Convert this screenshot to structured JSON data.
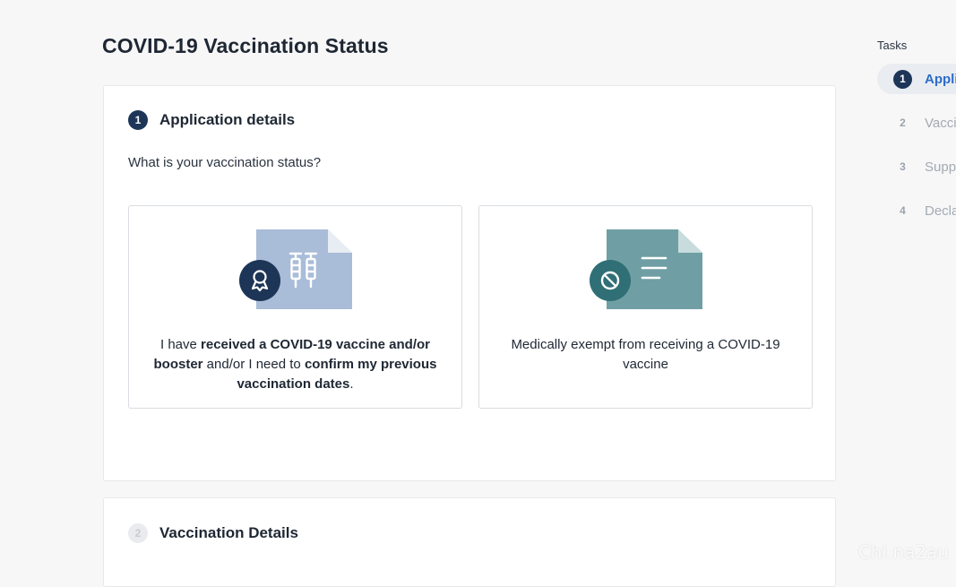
{
  "page": {
    "title": "COVID-19 Vaccination Status"
  },
  "step1": {
    "number": "1",
    "heading": "Application details",
    "question": "What is your vaccination status?",
    "option_vaccinated": {
      "t1": "I have ",
      "b1": "received a COVID-19 vaccine and/or booster",
      "t2": " and/or I need to ",
      "b2": "confirm my previous vaccination dates",
      "t3": ".",
      "icon": "vaccine-certificate-icon"
    },
    "option_exempt": {
      "text": "Medically exempt from receiving a COVID-19 vaccine",
      "icon": "exemption-document-icon"
    }
  },
  "step2": {
    "number": "2",
    "heading": "Vaccination Details"
  },
  "tasks": {
    "title": "Tasks",
    "items": [
      {
        "number": "1",
        "label": "Appli",
        "active": true
      },
      {
        "number": "2",
        "label": "Vacci",
        "active": false
      },
      {
        "number": "3",
        "label": "Suppo",
        "active": false
      },
      {
        "number": "4",
        "label": "Decla",
        "active": false
      }
    ]
  },
  "watermark": "Chi.na2au",
  "colors": {
    "navy": "#1d3557",
    "vaccine_doc": "#a9bcd8",
    "exempt_doc": "#6f9fa4",
    "exempt_badge": "#2f6f75",
    "active_task": "#2d6cc8"
  }
}
